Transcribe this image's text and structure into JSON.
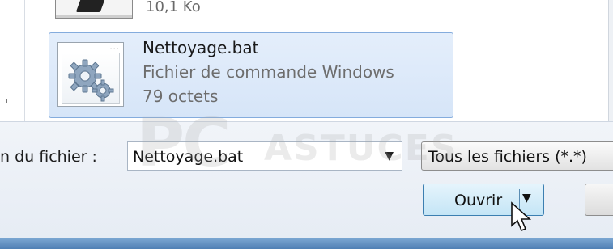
{
  "file_list": {
    "previous_item": {
      "size": "10,1 Ko"
    },
    "selected_item": {
      "name": "Nettoyage.bat",
      "type": "Fichier de commande Windows",
      "size": "79 octets",
      "icon": "batch-file-gear-icon"
    }
  },
  "bottom_bar": {
    "filename_label": "n du fichier :",
    "filename_value": "Nettoyage.bat",
    "filter_value": "Tous les fichiers (*.*)",
    "open_button_label": "Ouvrir"
  },
  "watermark": {
    "text_main": "PC",
    "text_secondary": "ASTUCES"
  },
  "colors": {
    "selection_fill": "#d9e7f9",
    "selection_border": "#84acdd",
    "open_button": "#c4e5f6",
    "footer": "#5a87bb"
  }
}
